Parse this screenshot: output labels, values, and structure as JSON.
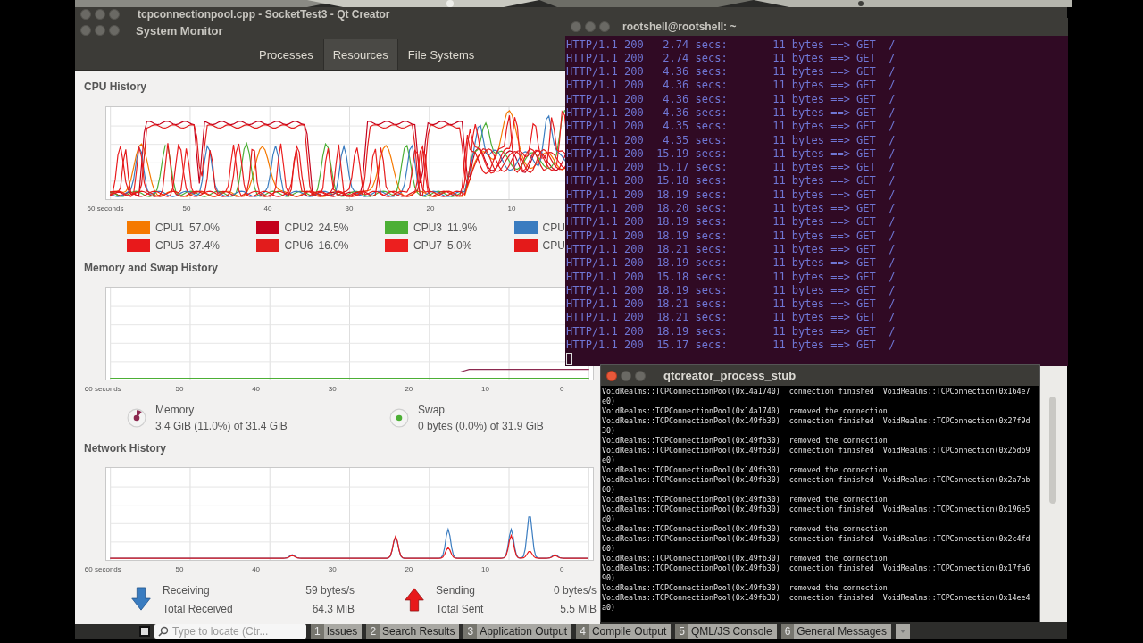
{
  "qt_creator": {
    "title": "tcpconnectionpool.cpp - SocketTest3 - Qt Creator",
    "locator": {
      "placeholder": "Type to locate (Ctr..."
    },
    "output_tabs": [
      {
        "number": "1",
        "label": "Issues"
      },
      {
        "number": "2",
        "label": "Search Results"
      },
      {
        "number": "3",
        "label": "Application Output"
      },
      {
        "number": "4",
        "label": "Compile Output"
      },
      {
        "number": "5",
        "label": "QML/JS Console"
      },
      {
        "number": "6",
        "label": "General Messages"
      }
    ]
  },
  "system_monitor": {
    "title": "System Monitor",
    "tabs": [
      {
        "label": "Processes",
        "selected": false
      },
      {
        "label": "Resources",
        "selected": true
      },
      {
        "label": "File Systems",
        "selected": false
      }
    ],
    "cpu_history": {
      "title": "CPU History",
      "x_labels": [
        "60 seconds",
        "50",
        "40",
        "30",
        "20",
        "10"
      ],
      "legend": [
        {
          "label": "CPU1",
          "value": "57.0%",
          "color": "#f57900"
        },
        {
          "label": "CPU2",
          "value": "24.5%",
          "color": "#c4001c"
        },
        {
          "label": "CPU3",
          "value": "11.9%",
          "color": "#4caf35"
        },
        {
          "label": "CPU",
          "color": "#3a7cc0"
        },
        {
          "label": "CPU5",
          "value": "37.4%",
          "color": "#e8191b"
        },
        {
          "label": "CPU6",
          "value": "16.0%",
          "color": "#e21c1c"
        },
        {
          "label": "CPU7",
          "value": "5.0%",
          "color": "#ec1f1f"
        },
        {
          "label": "CPU",
          "color": "#e41a1a"
        }
      ]
    },
    "memory_history": {
      "title": "Memory and Swap History",
      "x_labels": [
        "60 seconds",
        "50",
        "40",
        "30",
        "20",
        "10",
        "0"
      ],
      "memory": {
        "label": "Memory",
        "reading": "3.4 GiB (11.0%) of 31.4 GiB",
        "level": 0.11,
        "color": "#8c2950"
      },
      "swap": {
        "label": "Swap",
        "reading": "0 bytes (0.0%) of 31.9 GiB",
        "level": 0,
        "color": "#4caf35"
      }
    },
    "network_history": {
      "title": "Network History",
      "x_labels": [
        "60 seconds",
        "50",
        "40",
        "30",
        "20",
        "10",
        "0"
      ],
      "receiving": {
        "label": "Receiving",
        "rate": "59 bytes/s",
        "total_label": "Total Received",
        "total": "64.3 MiB",
        "color": "#3a7cc0"
      },
      "sending": {
        "label": "Sending",
        "rate": "0 bytes/s",
        "total_label": "Total Sent",
        "total": "5.5 MiB",
        "color": "#e8191b"
      }
    }
  },
  "terminal": {
    "title": "rootshell@rootshell: ~",
    "lines": [
      "HTTP/1.1 200   2.74 secs:       11 bytes ==> GET  /",
      "HTTP/1.1 200   2.74 secs:       11 bytes ==> GET  /",
      "HTTP/1.1 200   4.36 secs:       11 bytes ==> GET  /",
      "HTTP/1.1 200   4.36 secs:       11 bytes ==> GET  /",
      "HTTP/1.1 200   4.36 secs:       11 bytes ==> GET  /",
      "HTTP/1.1 200   4.36 secs:       11 bytes ==> GET  /",
      "HTTP/1.1 200   4.35 secs:       11 bytes ==> GET  /",
      "HTTP/1.1 200   4.35 secs:       11 bytes ==> GET  /",
      "HTTP/1.1 200  15.19 secs:       11 bytes ==> GET  /",
      "HTTP/1.1 200  15.17 secs:       11 bytes ==> GET  /",
      "HTTP/1.1 200  15.18 secs:       11 bytes ==> GET  /",
      "HTTP/1.1 200  18.19 secs:       11 bytes ==> GET  /",
      "HTTP/1.1 200  18.20 secs:       11 bytes ==> GET  /",
      "HTTP/1.1 200  18.19 secs:       11 bytes ==> GET  /",
      "HTTP/1.1 200  18.19 secs:       11 bytes ==> GET  /",
      "HTTP/1.1 200  18.21 secs:       11 bytes ==> GET  /",
      "HTTP/1.1 200  18.19 secs:       11 bytes ==> GET  /",
      "HTTP/1.1 200  15.18 secs:       11 bytes ==> GET  /",
      "HTTP/1.1 200  18.19 secs:       11 bytes ==> GET  /",
      "HTTP/1.1 200  18.21 secs:       11 bytes ==> GET  /",
      "HTTP/1.1 200  18.21 secs:       11 bytes ==> GET  /",
      "HTTP/1.1 200  18.19 secs:       11 bytes ==> GET  /",
      "HTTP/1.1 200  15.17 secs:       11 bytes ==> GET  /"
    ]
  },
  "process_stub": {
    "title": "qtcreator_process_stub",
    "lines": [
      "VoidRealms::TCPConnectionPool(0x14a1740)  connection finished  VoidRealms::TCPConnection(0x164e7e0)",
      "VoidRealms::TCPConnectionPool(0x14a1740)  removed the connection",
      "VoidRealms::TCPConnectionPool(0x149fb30)  connection finished  VoidRealms::TCPConnection(0x27f9d30)",
      "VoidRealms::TCPConnectionPool(0x149fb30)  removed the connection",
      "VoidRealms::TCPConnectionPool(0x149fb30)  connection finished  VoidRealms::TCPConnection(0x25d69e0)",
      "VoidRealms::TCPConnectionPool(0x149fb30)  removed the connection",
      "VoidRealms::TCPConnectionPool(0x149fb30)  connection finished  VoidRealms::TCPConnection(0x2a7ab00)",
      "VoidRealms::TCPConnectionPool(0x149fb30)  removed the connection",
      "VoidRealms::TCPConnectionPool(0x149fb30)  connection finished  VoidRealms::TCPConnection(0x196e5d0)",
      "VoidRealms::TCPConnectionPool(0x149fb30)  removed the connection",
      "VoidRealms::TCPConnectionPool(0x149fb30)  connection finished  VoidRealms::TCPConnection(0x2c4fd60)",
      "VoidRealms::TCPConnectionPool(0x149fb30)  removed the connection",
      "VoidRealms::TCPConnectionPool(0x149fb30)  connection finished  VoidRealms::TCPConnection(0x17fa690)",
      "VoidRealms::TCPConnectionPool(0x149fb30)  removed the connection",
      "VoidRealms::TCPConnectionPool(0x149fb30)  connection finished  VoidRealms::TCPConnection(0x14ee4a0)"
    ]
  }
}
